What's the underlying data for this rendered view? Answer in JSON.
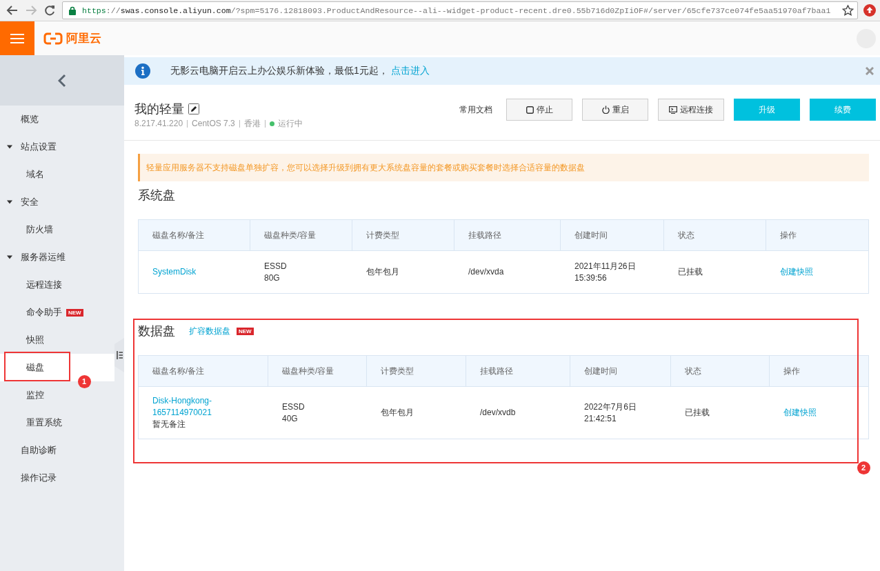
{
  "browser": {
    "url": {
      "scheme": "https",
      "separator": "://",
      "host": "swas.console.aliyun.com",
      "path": "/?spm=5176.12818093.ProductAndResource--ali--widget-product-recent.dre0.55b716d0ZpIiOF#/server/65cfe737ce074fe5aa51970af7baa1"
    }
  },
  "top_bar": {
    "logo": "阿里云"
  },
  "sidebar": {
    "items": [
      {
        "label": "概览",
        "selected": false
      },
      {
        "label": "站点设置",
        "selected": false,
        "expanded": true,
        "children": [
          {
            "label": "域名",
            "selected": false
          }
        ]
      },
      {
        "label": "安全",
        "selected": false,
        "expanded": true,
        "children": [
          {
            "label": "防火墙",
            "selected": false
          }
        ]
      },
      {
        "label": "服务器运维",
        "selected": false,
        "expanded": true,
        "children": [
          {
            "label": "远程连接",
            "selected": false
          },
          {
            "label": "命令助手",
            "badge": "NEW",
            "selected": false
          },
          {
            "label": "快照",
            "selected": false
          },
          {
            "label": "磁盘",
            "selected": true
          },
          {
            "label": "监控",
            "selected": false
          },
          {
            "label": "重置系统",
            "selected": false
          }
        ]
      },
      {
        "label": "自助诊断",
        "selected": false
      },
      {
        "label": "操作记录",
        "selected": false
      }
    ]
  },
  "banner": {
    "text": "无影云电脑开启云上办公娱乐新体验，最低1元起，",
    "link": "点击进入"
  },
  "instance": {
    "name": "我的轻量",
    "ip": "8.217.41.220",
    "os": "CentOS 7.3",
    "region": "香港",
    "status": "运行中",
    "running": true
  },
  "actions": [
    {
      "label": "常用文档",
      "kind": "link"
    },
    {
      "label": "停止",
      "kind": "stop"
    },
    {
      "label": "重启",
      "kind": "restart"
    },
    {
      "label": "远程连接",
      "kind": "remote"
    },
    {
      "label": "升级",
      "kind": "primary"
    },
    {
      "label": "续费",
      "kind": "primary"
    }
  ],
  "notice": {
    "text": "轻量应用服务器不支持磁盘单独扩容，您可以选择升级到拥有更大系统盘容量的套餐或购买套餐时选择合适容量的数据盘"
  },
  "system_disk": {
    "title": "系统盘",
    "table": {
      "columns": [
        "磁盘名称/备注",
        "磁盘种类/容量",
        "计费类型",
        "挂载路径",
        "创建时间",
        "状态",
        "操作"
      ],
      "rows": [
        {
          "name": "SystemDisk",
          "type": "ESSD",
          "size": "80G",
          "billing": "包年包月",
          "mount": "/dev/xvda",
          "created_date": "2021年11月26日",
          "created_time": "15:39:56",
          "status": "已挂载",
          "action": "创建快照"
        }
      ]
    }
  },
  "data_disk": {
    "title": "数据盘",
    "link": "扩容数据盘",
    "badge": "NEW",
    "table": {
      "columns": [
        "磁盘名称/备注",
        "磁盘种类/容量",
        "计费类型",
        "挂载路径",
        "创建时间",
        "状态",
        "操作"
      ],
      "rows": [
        {
          "name": "Disk-Hongkong-1657114970021",
          "remark": "暂无备注",
          "type": "ESSD",
          "size": "40G",
          "billing": "包年包月",
          "mount": "/dev/xvdb",
          "created_date": "2022年7月6日",
          "created_time": "21:42:51",
          "status": "已挂载",
          "action": "创建快照"
        }
      ]
    }
  },
  "annotations": [
    {
      "label": "1"
    },
    {
      "label": "2"
    }
  ]
}
